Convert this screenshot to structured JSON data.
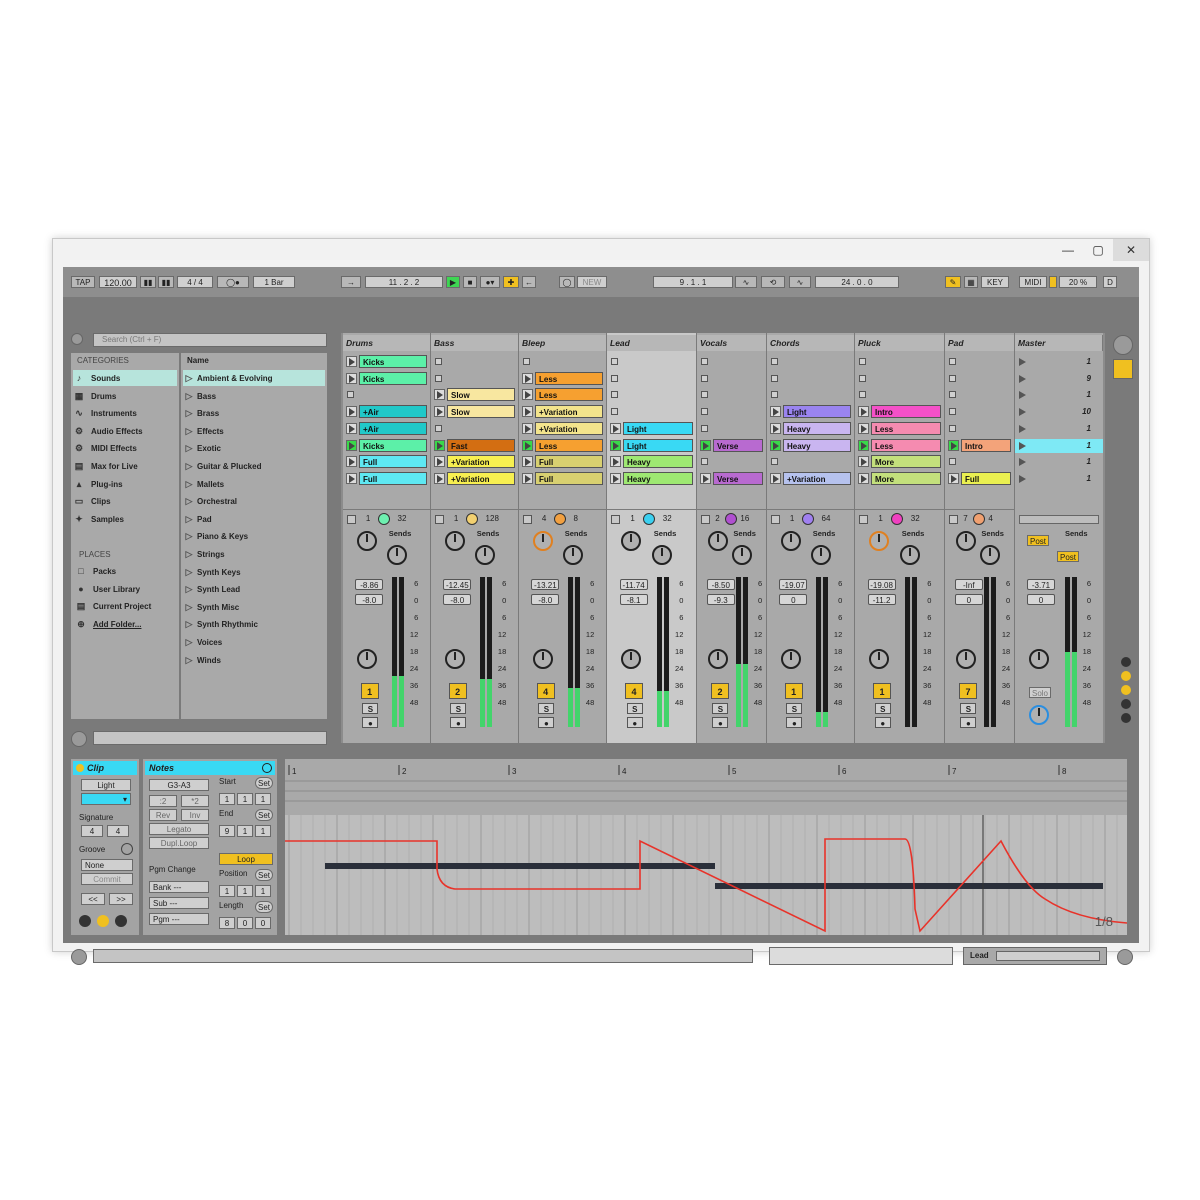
{
  "window": {
    "minimize_icon": "minimize-icon",
    "maximize_icon": "maximize-icon",
    "close_icon": "close-icon"
  },
  "transport": {
    "tap": "TAP",
    "tempo": "120.00",
    "signature": "4 / 4",
    "quantize": "1 Bar",
    "position": "11 .   2 .   2",
    "loop_start": "9 .   1 .   1",
    "loop_length": "24 .   0 .   0",
    "new": "NEW",
    "key": "KEY",
    "midi": "MIDI",
    "cpu": "20 %",
    "disk": "D"
  },
  "browser": {
    "search_placeholder": "Search (Ctrl + F)",
    "categories_label": "CATEGORIES",
    "name_label": "Name",
    "places_label": "PLACES",
    "categories": [
      {
        "label": "Sounds",
        "icon": "note-icon"
      },
      {
        "label": "Drums",
        "icon": "drum-grid-icon"
      },
      {
        "label": "Instruments",
        "icon": "wave-icon"
      },
      {
        "label": "Audio Effects",
        "icon": "audio-fx-icon"
      },
      {
        "label": "MIDI Effects",
        "icon": "midi-fx-icon"
      },
      {
        "label": "Max for Live",
        "icon": "max-icon"
      },
      {
        "label": "Plug-ins",
        "icon": "plugin-icon"
      },
      {
        "label": "Clips",
        "icon": "clip-icon"
      },
      {
        "label": "Samples",
        "icon": "sample-icon"
      }
    ],
    "places": [
      {
        "label": "Packs",
        "icon": "packs-icon"
      },
      {
        "label": "User Library",
        "icon": "user-icon"
      },
      {
        "label": "Current Project",
        "icon": "project-icon"
      },
      {
        "label": "Add Folder...",
        "icon": "add-icon"
      }
    ],
    "names": [
      "Ambient & Evolving",
      "Bass",
      "Brass",
      "Effects",
      "Exotic",
      "Guitar & Plucked",
      "Mallets",
      "Orchestral",
      "Pad",
      "Piano & Keys",
      "Strings",
      "Synth Keys",
      "Synth Lead",
      "Synth Misc",
      "Synth Rhythmic",
      "Voices",
      "Winds"
    ]
  },
  "tracks": [
    {
      "name": "Drums",
      "color": "#6ef0b0",
      "num": "1",
      "send": "32",
      "vol": "-8.86",
      "pan": "-8.0",
      "meter": 0.34,
      "clips": [
        {
          "r": 0,
          "t": "Kicks",
          "c": "#5cf0a8"
        },
        {
          "r": 1,
          "t": "Kicks",
          "c": "#5cf0a8"
        },
        {
          "r": 3,
          "t": "+Air",
          "c": "#21c8c8"
        },
        {
          "r": 4,
          "t": "+Air",
          "c": "#21c8c8"
        },
        {
          "r": 5,
          "t": "Kicks",
          "c": "#5cf0a8",
          "on": true
        },
        {
          "r": 6,
          "t": "Full",
          "c": "#5ee8f2"
        },
        {
          "r": 7,
          "t": "Full",
          "c": "#5ee8f2"
        }
      ]
    },
    {
      "name": "Bass",
      "color": "#f2d070",
      "num": "2",
      "send": "128",
      "vol": "-12.45",
      "pan": "-8.0",
      "meter": 0.32,
      "clips": [
        {
          "r": 2,
          "t": "Slow",
          "c": "#f8e7a0"
        },
        {
          "r": 3,
          "t": "Slow",
          "c": "#f8e7a0"
        },
        {
          "r": 5,
          "t": "Fast",
          "c": "#d36e12",
          "on": true
        },
        {
          "r": 6,
          "t": "+Variation",
          "c": "#f7ef50"
        },
        {
          "r": 7,
          "t": "+Variation",
          "c": "#f7ef50"
        }
      ]
    },
    {
      "name": "Bleep",
      "color": "#f2a040",
      "num": "4",
      "send": "8",
      "vol": "-13.21",
      "pan": "-8.0",
      "meter": 0.26,
      "clips": [
        {
          "r": 1,
          "t": "Less",
          "c": "#f6a030"
        },
        {
          "r": 2,
          "t": "Less",
          "c": "#f6a030"
        },
        {
          "r": 3,
          "t": "+Variation",
          "c": "#f3e48c"
        },
        {
          "r": 4,
          "t": "+Variation",
          "c": "#f3e48c"
        },
        {
          "r": 5,
          "t": "Less",
          "c": "#f6a030",
          "on": true
        },
        {
          "r": 6,
          "t": "Full",
          "c": "#d8d070"
        },
        {
          "r": 7,
          "t": "Full",
          "c": "#d8d070"
        }
      ]
    },
    {
      "name": "Lead",
      "color": "#3cd0f0",
      "num": "4",
      "send": "32",
      "vol": "-11.74",
      "pan": "-8.1",
      "meter": 0.24,
      "clips": [
        {
          "r": 4,
          "t": "Light",
          "c": "#39d9f4"
        },
        {
          "r": 5,
          "t": "Light",
          "c": "#39d9f4",
          "on": true
        },
        {
          "r": 6,
          "t": "Heavy",
          "c": "#9ee872"
        },
        {
          "r": 7,
          "t": "Heavy",
          "c": "#9ee872"
        }
      ]
    },
    {
      "name": "Vocals",
      "color": "#b050d0",
      "num": "2",
      "send": "16",
      "vol": "-8.50",
      "pan": "-9.3",
      "meter": 0.42,
      "clips": [
        {
          "r": 5,
          "t": "Verse",
          "c": "#b86ad0",
          "on": true
        },
        {
          "r": 7,
          "t": "Verse",
          "c": "#b86ad0"
        }
      ]
    },
    {
      "name": "Chords",
      "color": "#a080f0",
      "num": "1",
      "send": "64",
      "vol": "-19.07",
      "pan": "0",
      "meter": 0.1,
      "clips": [
        {
          "r": 3,
          "t": "Light",
          "c": "#9a84f0"
        },
        {
          "r": 4,
          "t": "Heavy",
          "c": "#c9b5f0"
        },
        {
          "r": 5,
          "t": "Heavy",
          "c": "#c9b5f0",
          "on": true
        },
        {
          "r": 7,
          "t": "+Variation",
          "c": "#b6c2ee"
        }
      ]
    },
    {
      "name": "Pluck",
      "color": "#f040c0",
      "num": "1",
      "send": "32",
      "vol": "-19.08",
      "pan": "-11.2",
      "meter": 0.0,
      "clips": [
        {
          "r": 3,
          "t": "Intro",
          "c": "#f450c8"
        },
        {
          "r": 4,
          "t": "Less",
          "c": "#f58bb0"
        },
        {
          "r": 5,
          "t": "Less",
          "c": "#f58bb0",
          "on": true
        },
        {
          "r": 6,
          "t": "More",
          "c": "#c3e07c"
        },
        {
          "r": 7,
          "t": "More",
          "c": "#c3e07c"
        }
      ]
    },
    {
      "name": "Pad",
      "color": "#f0a070",
      "num": "7",
      "send": "4",
      "vol": "-Inf",
      "pan": "0",
      "meter": 0.0,
      "clips": [
        {
          "r": 5,
          "t": "Intro",
          "c": "#f3a37a",
          "on": true
        },
        {
          "r": 7,
          "t": "Full",
          "c": "#eaf050"
        }
      ]
    }
  ],
  "master": {
    "name": "Master",
    "scenes": [
      "1",
      "9",
      "1",
      "10",
      "1",
      "1",
      "1",
      "1"
    ],
    "playing_row": 5,
    "vol": "-3.71",
    "pan": "0",
    "post": "Post",
    "solo": "Solo",
    "meter": 0.5
  },
  "mixer": {
    "sends": "Sends",
    "scale": [
      "6",
      "0",
      "6",
      "12",
      "18",
      "24",
      "36",
      "48"
    ],
    "solo": "S"
  },
  "clip_view": {
    "clip_label": "Clip",
    "clip_name": "Light",
    "signature_label": "Signature",
    "sig_num": "4",
    "sig_den": "4",
    "groove_label": "Groove",
    "groove_value": "None",
    "commit": "Commit",
    "nav_prev": "<<",
    "nav_next": ">>",
    "notes_label": "Notes",
    "range": "G3-A3",
    "div2": ":2",
    "mul2": "*2",
    "rev": "Rev",
    "inv": "Inv",
    "legato": "Legato",
    "dupl": "Dupl.Loop",
    "pgm_change": "Pgm Change",
    "bank": "Bank ---",
    "sub": "Sub ---",
    "pgm": "Pgm ---",
    "start_label": "Start",
    "end_label": "End",
    "loop": "Loop",
    "position_label": "Position",
    "length_label": "Length",
    "set": "Set",
    "start_vals": [
      "1",
      "1",
      "1"
    ],
    "end_vals": [
      "9",
      "1",
      "1"
    ],
    "pos_vals": [
      "1",
      "1",
      "1"
    ],
    "len_vals": [
      "8",
      "0",
      "0"
    ]
  },
  "editor": {
    "ruler": [
      "1",
      "2",
      "3",
      "4",
      "5",
      "6",
      "7",
      "8"
    ],
    "quant": "1/8"
  },
  "status": {
    "track_label": "Lead"
  }
}
